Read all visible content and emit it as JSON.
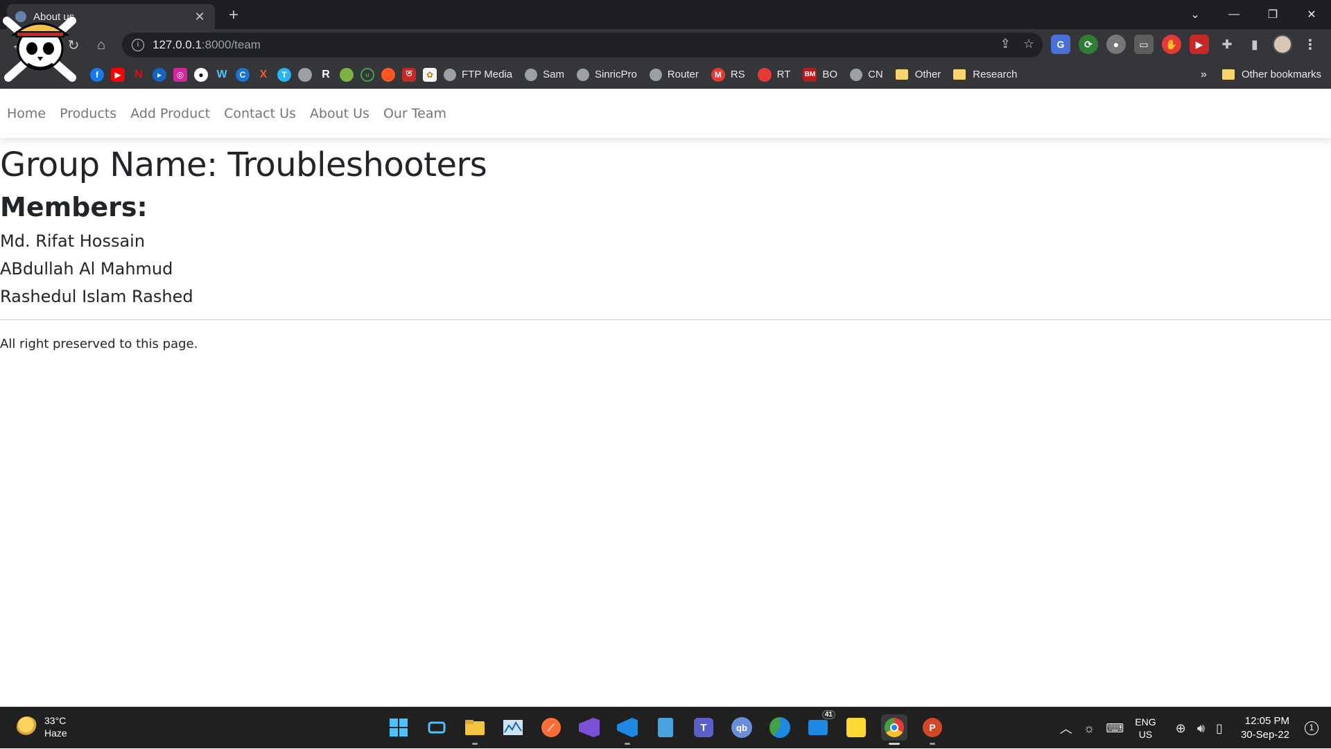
{
  "browser": {
    "tab_title": "About us",
    "tab_close": "✕",
    "new_tab": "+",
    "window_controls": [
      "⌄",
      "—",
      "❐",
      "✕"
    ],
    "url_host": "127.0.0.1",
    "url_path": ":8000/team",
    "bookmarks": [
      {
        "label": "FTP Media",
        "icon": "globe"
      },
      {
        "label": "Sam",
        "icon": "globe"
      },
      {
        "label": "SinricPro",
        "icon": "globe"
      },
      {
        "label": "Router",
        "icon": "globe"
      },
      {
        "label": "RS",
        "icon": "m-logo"
      },
      {
        "label": "RT",
        "icon": "tomato"
      },
      {
        "label": "BO",
        "icon": "bm-logo"
      },
      {
        "label": "CN",
        "icon": "globe"
      },
      {
        "label": "Other",
        "icon": "folder"
      },
      {
        "label": "Research",
        "icon": "folder"
      }
    ],
    "bookmarks_more": "»",
    "other_bookmarks": "Other bookmarks"
  },
  "site": {
    "nav": [
      "Home",
      "Products",
      "Add Product",
      "Contact Us",
      "About Us",
      "Our Team"
    ],
    "group_heading": "Group Name: Troubleshooters",
    "members_heading": "Members:",
    "members": [
      "Md. Rifat Hossain",
      "ABdullah Al Mahmud",
      "Rashedul Islam Rashed"
    ],
    "footer": "All right preserved to this page."
  },
  "taskbar": {
    "temperature": "33°C",
    "condition": "Haze",
    "lang_top": "ENG",
    "lang_bottom": "US",
    "time": "12:05 PM",
    "date": "30-Sep-22",
    "notification_count": "1",
    "mail_badge": "41"
  },
  "colors": {
    "chrome_dark": "#1e1f22",
    "chrome_toolbar": "#35363a",
    "nav_link": "#6c757d",
    "heading": "#212529"
  }
}
